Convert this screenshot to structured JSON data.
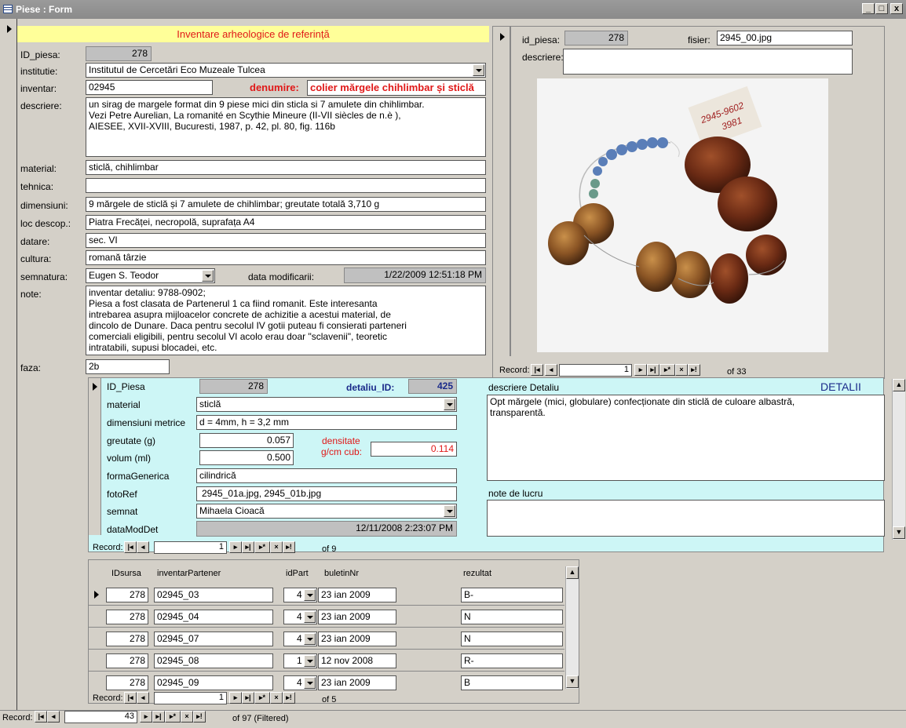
{
  "window": {
    "title": "Piese : Form",
    "min": "_",
    "max": "□",
    "close": "x"
  },
  "header": {
    "banner": "Inventare arheologice de referință"
  },
  "main": {
    "id_label": "ID_piesa:",
    "id_value": "278",
    "institutie_label": "institutie:",
    "institutie_value": "Institutul de Cercetări Eco Muzeale Tulcea",
    "inventar_label": "inventar:",
    "inventar_value": "02945",
    "denumire_label": "denumire:",
    "denumire_value": "colier mărgele chihlimbar și sticlă",
    "descriere_label": "descriere:",
    "descriere_lines": [
      "un sirag de margele format din 9 piese mici din sticla si 7 amulete din chihlimbar.",
      "Vezi Petre Aurelian, La romanité en Scythie Mineure (II-VII siècles de n.è ),",
      "AIESEE, XVII-XVIII, Bucuresti, 1987, p. 42, pl. 80, fig. 116b"
    ],
    "material_label": "material:",
    "material_value": "sticlă, chihlimbar",
    "tehnica_label": "tehnica:",
    "tehnica_value": "",
    "dimensiuni_label": "dimensiuni:",
    "dimensiuni_value": "9 mărgele de sticlă și 7 amulete de chihlimbar; greutate totală 3,710 g",
    "loc_label": "loc descop.:",
    "loc_value": "Piatra Frecăței, necropolă, suprafața A4",
    "datare_label": "datare:",
    "datare_value": "sec. VI",
    "cultura_label": "cultura:",
    "cultura_value": "romană târzie",
    "semnatura_label": "semnatura:",
    "semnatura_value": "Eugen S. Teodor",
    "datamod_label": "data modificarii:",
    "datamod_value": "1/22/2009 12:51:18 PM",
    "note_label": "note:",
    "note_lines": [
      "inventar detaliu: 9788-0902;",
      "Piesa a fost clasata de Partenerul 1 ca fiind romanit. Este interesanta",
      "intrebarea asupra mijloacelor concrete de achizitie a acestui material, de",
      "dincolo de Dunare. Daca pentru secolul IV gotii puteau fi consierati parteneri",
      "comerciali eligibili, pentru secolul VI acolo erau doar \"sclavenii\", teoretic",
      "intratabili, supusi blocadei, etc."
    ],
    "faza_label": "faza:",
    "faza_value": "2b"
  },
  "photo_panel": {
    "id_label": "id_piesa:",
    "id_value": "278",
    "fisier_label": "fisier:",
    "fisier_value": "2945_00.jpg",
    "descriere_label": "descriere:",
    "descriere_value": "",
    "nav": {
      "label": "Record:",
      "current": "1",
      "of": "of 33"
    }
  },
  "detail": {
    "id_label": "ID_Piesa",
    "id_value": "278",
    "detaliu_label": "detaliu_ID:",
    "detaliu_value": "425",
    "material_label": "material",
    "material_value": "sticlă",
    "dimmet_label": "dimensiuni metrice",
    "dimmet_value": "d = 4mm, h = 3,2 mm",
    "greutate_label": "greutate (g)",
    "greutate_value": "0.057",
    "volum_label": "volum (ml)",
    "volum_value": "0.500",
    "densitate_label1": "densitate",
    "densitate_label2": "g/cm cub:",
    "densitate_value": "0.114",
    "forma_label": "formaGenerica",
    "forma_value": "cilindrică",
    "foto_label": "fotoRef",
    "foto_value": "2945_01a.jpg, 2945_01b.jpg",
    "semnat_label": "semnat",
    "semnat_value": "Mihaela Cioacă",
    "datamod_label": "dataModDet",
    "datamod_value": "12/11/2008 2:23:07 PM",
    "descdet_label": "descriere Detaliu",
    "detalii_title": "DETALII",
    "descdet_lines": [
      "Opt mărgele (mici, globulare) confecționate din sticlă de culoare albastră,",
      "transparentă."
    ],
    "note_label": "note de lucru",
    "note_value": "",
    "nav": {
      "label": "Record:",
      "current": "1",
      "of": "of 9"
    }
  },
  "partners": {
    "headers": [
      "IDsursa",
      "inventarPartener",
      "idPart",
      "buletinNr",
      "rezultat"
    ],
    "rows": [
      {
        "id": "278",
        "inv": "02945_03",
        "part": "4",
        "bul": "23 ian 2009",
        "rez": "B-"
      },
      {
        "id": "278",
        "inv": "02945_04",
        "part": "4",
        "bul": "23 ian 2009",
        "rez": "N"
      },
      {
        "id": "278",
        "inv": "02945_07",
        "part": "4",
        "bul": "23 ian 2009",
        "rez": "N"
      },
      {
        "id": "278",
        "inv": "02945_08",
        "part": "1",
        "bul": "12 nov 2008",
        "rez": "R-"
      },
      {
        "id": "278",
        "inv": "02945_09",
        "part": "4",
        "bul": "23 ian 2009",
        "rez": "B"
      }
    ],
    "nav": {
      "label": "Record:",
      "current": "1",
      "of": "of 5"
    }
  },
  "main_nav": {
    "label": "Record:",
    "current": "43",
    "of": "of 97 (Filtered)"
  }
}
